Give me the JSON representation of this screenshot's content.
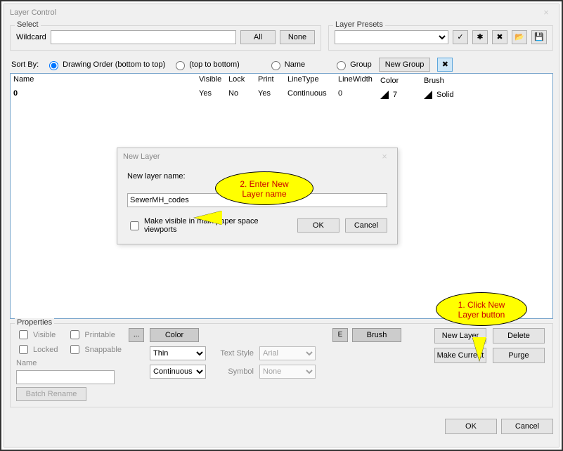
{
  "window": {
    "title": "Layer Control"
  },
  "select": {
    "legend": "Select",
    "wildcard_label": "Wildcard",
    "wildcard_value": "",
    "all_btn": "All",
    "none_btn": "None"
  },
  "presets": {
    "legend": "Layer Presets",
    "value": "",
    "icons": {
      "check": "✓",
      "asterisk": "✱",
      "delete": "✖",
      "open": "📂",
      "save": "💾"
    }
  },
  "sort": {
    "label": "Sort By:",
    "options": {
      "draw_order": "Drawing Order (bottom to top)",
      "top_to_bottom": "(top to bottom)",
      "name": "Name",
      "group": "Group"
    },
    "new_group_btn": "New Group",
    "x_icon": "✖"
  },
  "grid": {
    "headers": {
      "name": "Name",
      "visible": "Visible",
      "lock": "Lock",
      "print": "Print",
      "linetype": "LineType",
      "linewidth": "LineWidth",
      "color": "Color",
      "brush": "Brush"
    },
    "rows": [
      {
        "name": "0",
        "visible": "Yes",
        "lock": "No",
        "print": "Yes",
        "linetype": "Continuous",
        "linewidth": "0",
        "color": "7",
        "brush": "Solid"
      }
    ]
  },
  "modal": {
    "title": "New Layer",
    "name_label": "New layer name:",
    "name_value": "SewerMH_codes",
    "make_visible": "Make visible in main paper space viewports",
    "ok": "OK",
    "cancel": "Cancel"
  },
  "callouts": {
    "c1": "2. Enter New Layer name",
    "c2": "1. Click New Layer button"
  },
  "props": {
    "legend": "Properties",
    "checks": {
      "visible": "Visible",
      "printable": "Printable",
      "locked": "Locked",
      "snappable": "Snappable"
    },
    "name_label": "Name",
    "name_value": "",
    "batch_rename": "Batch Rename",
    "color_btn_icon": "...",
    "color_btn": "Color",
    "brush_btn_icon": "E",
    "brush_btn": "Brush",
    "line_weight": "Thin",
    "text_style_label": "Text Style",
    "text_style_value": "Arial",
    "linetype_value": "Continuous",
    "symbol_label": "Symbol",
    "symbol_value": "None",
    "buttons": {
      "new_layer": "New Layer",
      "delete": "Delete",
      "make_current": "Make Current",
      "purge": "Purge"
    }
  },
  "footer": {
    "ok": "OK",
    "cancel": "Cancel"
  }
}
